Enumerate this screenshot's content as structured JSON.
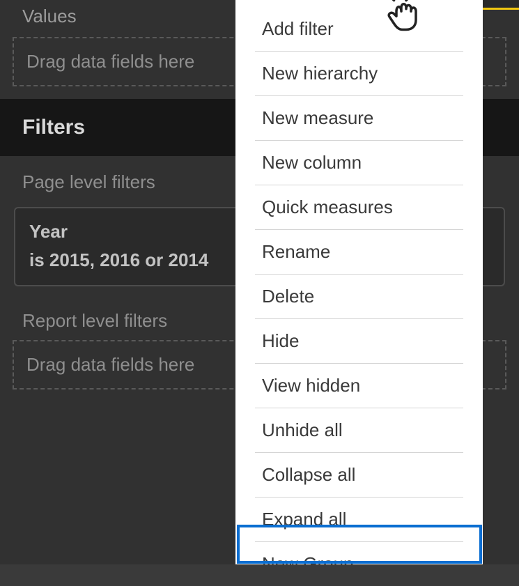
{
  "panel": {
    "values_label": "Values",
    "values_placeholder": "Drag data fields here",
    "filters_header": "Filters",
    "page_level_label": "Page level filters",
    "filter_card": {
      "field": "Year",
      "condition": "is 2015, 2016 or 2014"
    },
    "report_level_label": "Report level filters",
    "report_level_placeholder": "Drag data fields here"
  },
  "context_menu": {
    "items": [
      "Add filter",
      "New hierarchy",
      "New measure",
      "New column",
      "Quick measures",
      "Rename",
      "Delete",
      "Hide",
      "View hidden",
      "Unhide all",
      "Collapse all",
      "Expand all",
      "New Group"
    ]
  }
}
